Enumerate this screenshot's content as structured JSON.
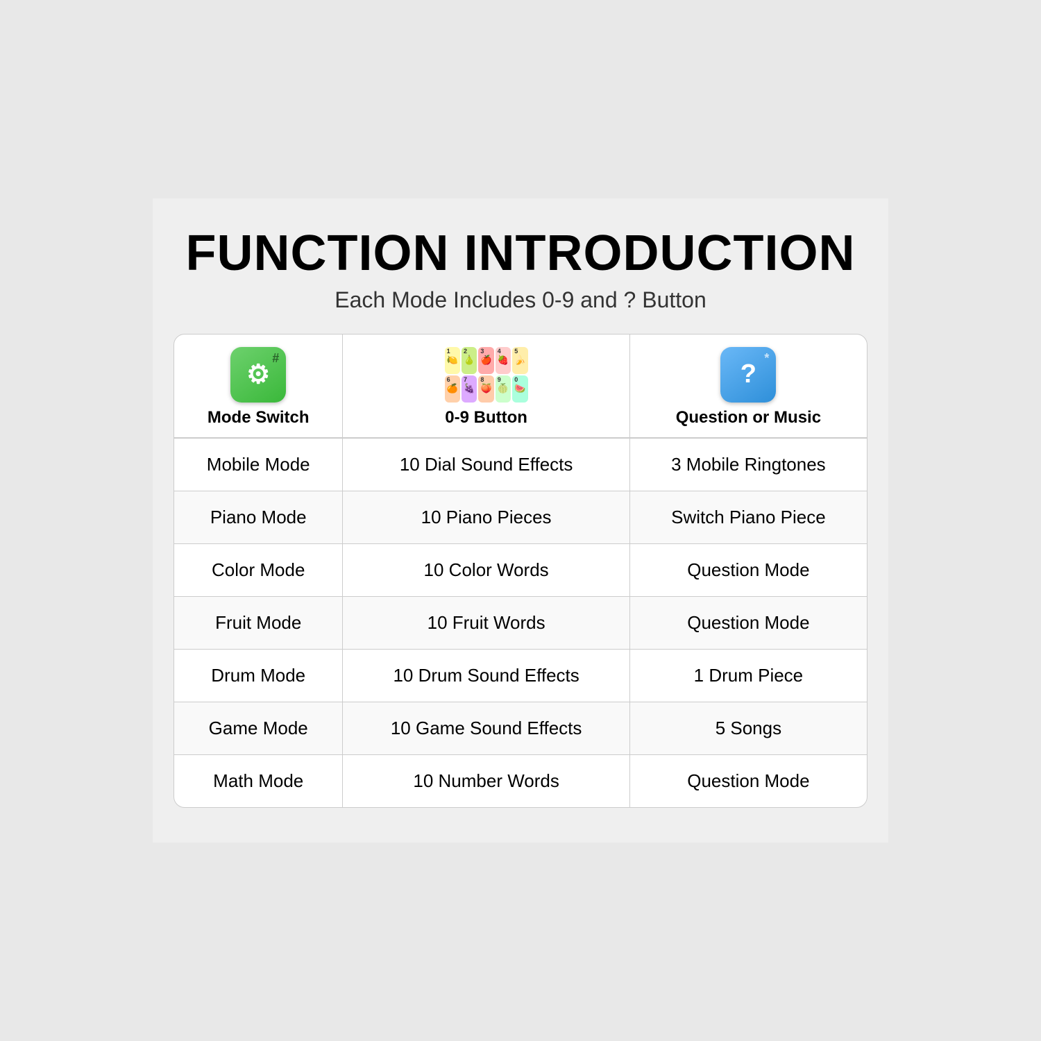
{
  "page": {
    "title": "FUNCTION INTRODUCTION",
    "subtitle": "Each Mode Includes 0-9 and ? Button"
  },
  "table": {
    "headers": [
      {
        "label": "Mode Switch",
        "icon": "mode-switch"
      },
      {
        "label": "0-9 Button",
        "icon": "button-grid"
      },
      {
        "label": "Question or Music",
        "icon": "question"
      }
    ],
    "rows": [
      {
        "mode": "Mobile Mode",
        "button": "10 Dial Sound Effects",
        "question": "3 Mobile Ringtones"
      },
      {
        "mode": "Piano Mode",
        "button": "10 Piano Pieces",
        "question": "Switch Piano Piece"
      },
      {
        "mode": "Color Mode",
        "button": "10 Color Words",
        "question": "Question Mode"
      },
      {
        "mode": "Fruit Mode",
        "button": "10 Fruit Words",
        "question": "Question Mode"
      },
      {
        "mode": "Drum Mode",
        "button": "10 Drum Sound Effects",
        "question": "1 Drum Piece"
      },
      {
        "mode": "Game Mode",
        "button": "10 Game Sound Effects",
        "question": "5 Songs"
      },
      {
        "mode": "Math Mode",
        "button": "10 Number Words",
        "question": "Question Mode"
      }
    ],
    "fruit_tiles": [
      {
        "num": "1",
        "emoji": "🍋",
        "bg": "#fff9aa"
      },
      {
        "num": "2",
        "emoji": "🍐",
        "bg": "#ccee88"
      },
      {
        "num": "3",
        "emoji": "🍎",
        "bg": "#ffaaaa"
      },
      {
        "num": "4",
        "emoji": "🍓",
        "bg": "#ffcccc"
      },
      {
        "num": "5",
        "emoji": "🍌",
        "bg": "#ffeeaa"
      },
      {
        "num": "6",
        "emoji": "🍊",
        "bg": "#ffd0aa"
      },
      {
        "num": "7",
        "emoji": "🍇",
        "bg": "#ddaaff"
      },
      {
        "num": "8",
        "emoji": "🍑",
        "bg": "#ffccaa"
      },
      {
        "num": "9",
        "emoji": "🍈",
        "bg": "#ccffcc"
      },
      {
        "num": "0",
        "emoji": "🍉",
        "bg": "#aaffdd"
      }
    ]
  }
}
